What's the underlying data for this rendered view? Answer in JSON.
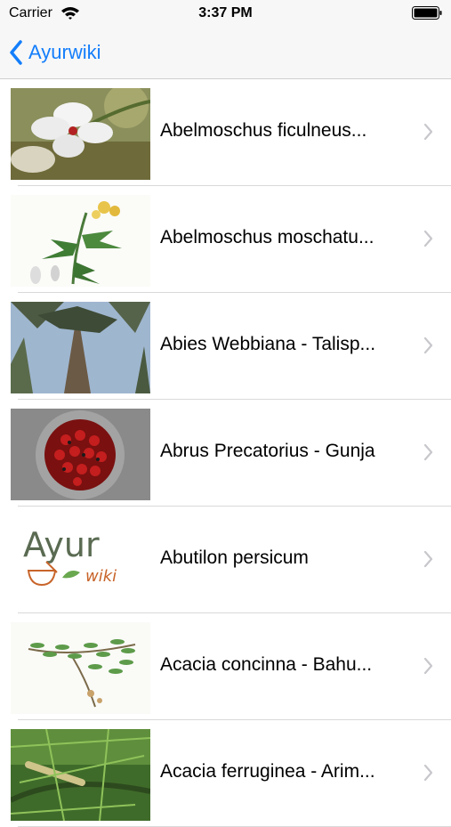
{
  "status_bar": {
    "carrier": "Carrier",
    "time": "3:37 PM"
  },
  "nav": {
    "back_label": "Ayurwiki",
    "accent_color": "#147efb"
  },
  "items": [
    {
      "title": "Abelmoschus ficulneus...",
      "thumb": "white-flower"
    },
    {
      "title": "Abelmoschus moschatu...",
      "thumb": "botanical-plant-drawing"
    },
    {
      "title": "Abies Webbiana - Talisp...",
      "thumb": "fir-tree-trunk"
    },
    {
      "title": "Abrus Precatorius - Gunja",
      "thumb": "red-seeds-bowl"
    },
    {
      "title": "Abutilon persicum",
      "thumb": "ayurwiki-logo",
      "logo_text": "Ayur",
      "logo_sub": "wiki"
    },
    {
      "title": "Acacia concinna - Bahu...",
      "thumb": "leaf-branch-drawing"
    },
    {
      "title": "Acacia ferruginea - Arim...",
      "thumb": "acacia-branch"
    }
  ]
}
